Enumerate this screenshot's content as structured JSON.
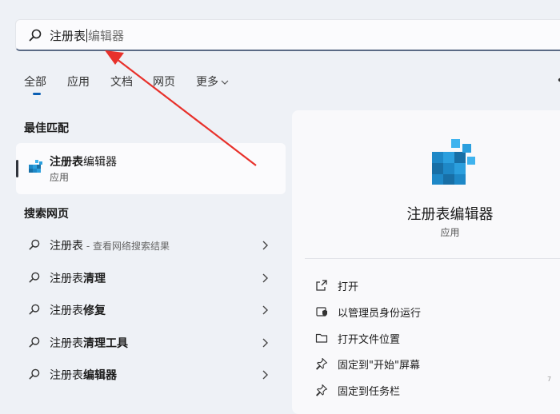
{
  "search": {
    "typed": "注册表",
    "autocomplete": "编辑器"
  },
  "tabs": [
    {
      "label": "全部"
    },
    {
      "label": "应用"
    },
    {
      "label": "文档"
    },
    {
      "label": "网页"
    },
    {
      "label": "更多"
    }
  ],
  "sections": {
    "best_match": "最佳匹配",
    "search_web": "搜索网页"
  },
  "best_match": {
    "title_bold": "注册表",
    "title_rest": "编辑器",
    "subtitle": "应用"
  },
  "web_results": [
    {
      "prefix": "注册表",
      "bold": "",
      "suffix": " - 查看网络搜索结果"
    },
    {
      "prefix": "注册表",
      "bold": "清理",
      "suffix": ""
    },
    {
      "prefix": "注册表",
      "bold": "修复",
      "suffix": ""
    },
    {
      "prefix": "注册表",
      "bold": "清理工具",
      "suffix": ""
    },
    {
      "prefix": "注册表",
      "bold": "编辑器",
      "suffix": ""
    }
  ],
  "detail": {
    "app_name": "注册表编辑器",
    "app_type": "应用",
    "actions": [
      {
        "label": "打开",
        "icon": "open-external-icon"
      },
      {
        "label": "以管理员身份运行",
        "icon": "admin-shield-icon"
      },
      {
        "label": "打开文件位置",
        "icon": "folder-icon"
      },
      {
        "label": "固定到\"开始\"屏幕",
        "icon": "pin-icon"
      },
      {
        "label": "固定到任务栏",
        "icon": "pin-icon"
      }
    ]
  },
  "colors": {
    "accent": "#0a5fb4",
    "annotation_arrow": "#e8312b",
    "registry_icon": "#1e88c7"
  },
  "corner_mark": "7"
}
